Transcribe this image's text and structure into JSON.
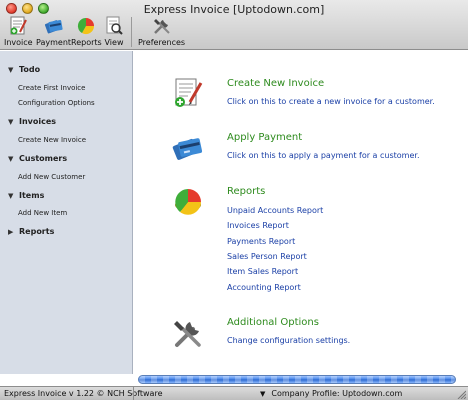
{
  "window": {
    "title": "Express Invoice [Uptodown.com]"
  },
  "toolbar": {
    "invoice": "Invoice",
    "payment": "Payment",
    "reports": "Reports",
    "view": "View",
    "preferences": "Preferences"
  },
  "sidebar": {
    "todo": {
      "label": "Todo",
      "items": [
        "Create First Invoice",
        "Configuration Options"
      ]
    },
    "invoices": {
      "label": "Invoices",
      "items": [
        "Create New Invoice"
      ]
    },
    "customers": {
      "label": "Customers",
      "items": [
        "Add New Customer"
      ]
    },
    "items": {
      "label": "Items",
      "items": [
        "Add New Item"
      ]
    },
    "reports": {
      "label": "Reports"
    }
  },
  "main": {
    "create_invoice": {
      "title": "Create New Invoice",
      "desc": "Click on this to create a new invoice for a customer."
    },
    "apply_payment": {
      "title": "Apply Payment",
      "desc": "Click on this to apply a payment for a customer."
    },
    "reports": {
      "title": "Reports",
      "links": [
        "Unpaid Accounts Report",
        "Invoices Report",
        "Payments Report",
        "Sales Person Report",
        "Item Sales Report",
        "Accounting Report"
      ]
    },
    "additional": {
      "title": "Additional Options",
      "desc": "Change configuration settings."
    }
  },
  "status": {
    "version": "Express Invoice v 1.22 © NCH Software",
    "profile": "Company Profile: Uptodown.com"
  },
  "colors": {
    "heading": "#2e8b1e",
    "link": "#1a3fa6",
    "sidebar": "#d7dde7"
  }
}
